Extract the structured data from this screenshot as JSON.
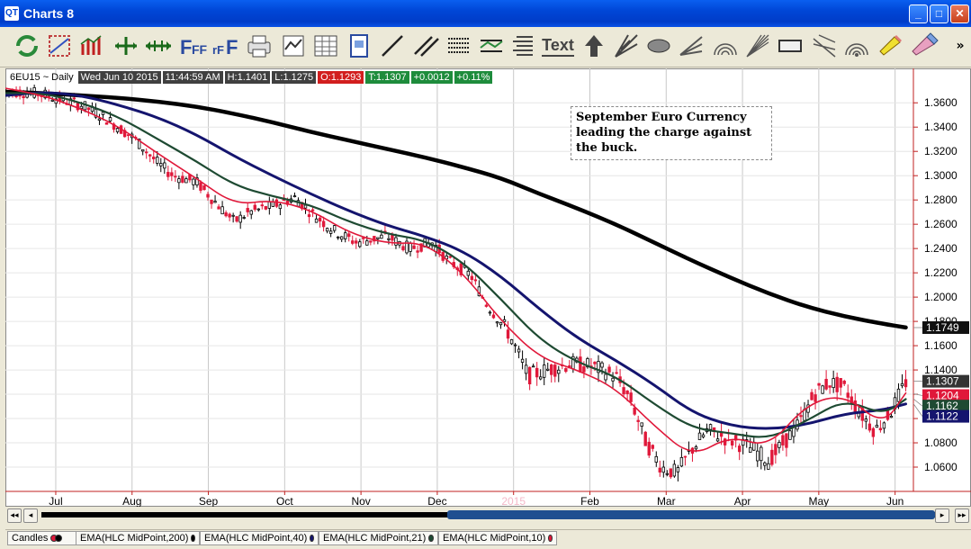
{
  "window": {
    "title": "Charts 8",
    "app_icon": "QT"
  },
  "toolbar": {
    "icons": [
      "refresh-icon",
      "studies-icon",
      "bar-chart-icon",
      "cursor-cross-icon",
      "cursor-arrows-icon",
      "font-size-icon",
      "font-size-small-icon",
      "print-icon",
      "chart-window-icon",
      "spreadsheet-icon",
      "page-setup-icon",
      "trendline-icon",
      "parallel-lines-icon",
      "horizontal-lines-icon",
      "channel-icon",
      "fibonacci-icon",
      "text-icon",
      "arrow-up-icon",
      "gann-fan-icon",
      "ellipse-icon",
      "speed-lines-icon",
      "fib-arcs-icon",
      "gann-lines-icon",
      "rectangle-icon",
      "andrews-fork-icon",
      "fib-circles-icon",
      "highlighter-icon",
      "eraser-icon"
    ],
    "text_tool_label": "Text",
    "overflow": "»"
  },
  "infobar": {
    "symbol": "6EU15 ~ Daily",
    "datetime": "Wed Jun 10 2015",
    "time": "11:44:59 AM",
    "high": "H:1.1401",
    "low": "L:1.1275",
    "open": "O:1.1293",
    "trade": "T:1.1307",
    "change": "+0.0012",
    "change_pct": "+0.11%"
  },
  "annotation": {
    "lines": [
      "September Euro Currency",
      "leading the charge against",
      "the buck."
    ]
  },
  "legend": {
    "items": [
      {
        "label": "Candles",
        "colors": [
          "#e0183a",
          "#000000"
        ]
      },
      {
        "label": "EMA(HLC MidPoint,200)",
        "color": "#000000"
      },
      {
        "label": "EMA(HLC MidPoint,40)",
        "color": "#14146e"
      },
      {
        "label": "EMA(HLC MidPoint,21)",
        "color": "#1e4a32"
      },
      {
        "label": "EMA(HLC MidPoint,10)",
        "color": "#e0183a"
      }
    ]
  },
  "chart_data": {
    "type": "line",
    "ylim": [
      1.04,
      1.375
    ],
    "y_ticks": [
      "1.3600",
      "1.3400",
      "1.3200",
      "1.3000",
      "1.2800",
      "1.2600",
      "1.2400",
      "1.2200",
      "1.2000",
      "1.1800",
      "1.1600",
      "1.1400",
      "1.1200",
      "1.1000",
      "1.0800",
      "1.0600"
    ],
    "x_ticks": [
      "Jul",
      "Aug",
      "Sep",
      "Oct",
      "Nov",
      "Dec",
      "2015",
      "Feb",
      "Mar",
      "Apr",
      "May",
      "Jun"
    ],
    "x_tick_pos": [
      0.66,
      1.66,
      2.66,
      3.66,
      4.66,
      5.66,
      6.66,
      7.66,
      8.66,
      9.66,
      10.66,
      11.66
    ],
    "x_range": [
      0,
      11.9
    ],
    "highlight_tick": "2015",
    "colors": {
      "ema200": "#000000",
      "ema40": "#14146e",
      "ema21": "#1e4a32",
      "ema10": "#e0183a",
      "candle_down": "#e0183a",
      "candle_up": "#000000"
    },
    "series": [
      {
        "name": "EMA(HLC MidPoint,200)",
        "points": [
          [
            0,
            1.369
          ],
          [
            0.5,
            1.368
          ],
          [
            1,
            1.366
          ],
          [
            1.5,
            1.364
          ],
          [
            2,
            1.361
          ],
          [
            2.5,
            1.357
          ],
          [
            3,
            1.351
          ],
          [
            3.5,
            1.344
          ],
          [
            4,
            1.336
          ],
          [
            4.5,
            1.329
          ],
          [
            5,
            1.322
          ],
          [
            5.5,
            1.315
          ],
          [
            6,
            1.307
          ],
          [
            6.5,
            1.298
          ],
          [
            7,
            1.285
          ],
          [
            7.5,
            1.273
          ],
          [
            8,
            1.26
          ],
          [
            8.5,
            1.245
          ],
          [
            9,
            1.23
          ],
          [
            9.5,
            1.216
          ],
          [
            10,
            1.203
          ],
          [
            10.5,
            1.192
          ],
          [
            11,
            1.184
          ],
          [
            11.5,
            1.178
          ],
          [
            11.8,
            1.175
          ]
        ]
      },
      {
        "name": "EMA(HLC MidPoint,40)",
        "points": [
          [
            0,
            1.366
          ],
          [
            0.5,
            1.369
          ],
          [
            1,
            1.366
          ],
          [
            1.5,
            1.358
          ],
          [
            2,
            1.348
          ],
          [
            2.5,
            1.334
          ],
          [
            3,
            1.316
          ],
          [
            3.5,
            1.3
          ],
          [
            4,
            1.285
          ],
          [
            4.5,
            1.271
          ],
          [
            5,
            1.259
          ],
          [
            5.5,
            1.25
          ],
          [
            6,
            1.238
          ],
          [
            6.5,
            1.217
          ],
          [
            7,
            1.19
          ],
          [
            7.5,
            1.166
          ],
          [
            8,
            1.148
          ],
          [
            8.5,
            1.128
          ],
          [
            9,
            1.105
          ],
          [
            9.5,
            1.094
          ],
          [
            10,
            1.091
          ],
          [
            10.5,
            1.095
          ],
          [
            11,
            1.104
          ],
          [
            11.5,
            1.107
          ],
          [
            11.8,
            1.112
          ]
        ]
      },
      {
        "name": "EMA(HLC MidPoint,21)",
        "points": [
          [
            0,
            1.368
          ],
          [
            0.5,
            1.368
          ],
          [
            1,
            1.36
          ],
          [
            1.5,
            1.348
          ],
          [
            2,
            1.33
          ],
          [
            2.5,
            1.312
          ],
          [
            3,
            1.292
          ],
          [
            3.5,
            1.283
          ],
          [
            4,
            1.276
          ],
          [
            4.5,
            1.262
          ],
          [
            5,
            1.252
          ],
          [
            5.5,
            1.247
          ],
          [
            6,
            1.229
          ],
          [
            6.5,
            1.198
          ],
          [
            7,
            1.165
          ],
          [
            7.5,
            1.146
          ],
          [
            8,
            1.135
          ],
          [
            8.5,
            1.112
          ],
          [
            9,
            1.092
          ],
          [
            9.5,
            1.088
          ],
          [
            10,
            1.083
          ],
          [
            10.5,
            1.098
          ],
          [
            11,
            1.116
          ],
          [
            11.5,
            1.103
          ],
          [
            11.8,
            1.116
          ]
        ]
      },
      {
        "name": "EMA(HLC MidPoint,10)",
        "points": [
          [
            0,
            1.372
          ],
          [
            0.5,
            1.366
          ],
          [
            1,
            1.355
          ],
          [
            1.5,
            1.34
          ],
          [
            2,
            1.318
          ],
          [
            2.5,
            1.298
          ],
          [
            3,
            1.276
          ],
          [
            3.5,
            1.28
          ],
          [
            4,
            1.272
          ],
          [
            4.5,
            1.253
          ],
          [
            5,
            1.244
          ],
          [
            5.5,
            1.245
          ],
          [
            6,
            1.22
          ],
          [
            6.5,
            1.18
          ],
          [
            7,
            1.15
          ],
          [
            7.5,
            1.14
          ],
          [
            8,
            1.125
          ],
          [
            8.5,
            1.094
          ],
          [
            9,
            1.068
          ],
          [
            9.5,
            1.086
          ],
          [
            10,
            1.076
          ],
          [
            10.5,
            1.112
          ],
          [
            11,
            1.12
          ],
          [
            11.5,
            1.094
          ],
          [
            11.8,
            1.121
          ]
        ]
      }
    ],
    "candle_path": [
      [
        0,
        1.37
      ],
      [
        0.5,
        1.367
      ],
      [
        1,
        1.358
      ],
      [
        1.3,
        1.348
      ],
      [
        1.7,
        1.33
      ],
      [
        2,
        1.31
      ],
      [
        2.2,
        1.3
      ],
      [
        2.5,
        1.295
      ],
      [
        2.8,
        1.275
      ],
      [
        3,
        1.262
      ],
      [
        3.2,
        1.27
      ],
      [
        3.5,
        1.275
      ],
      [
        3.8,
        1.282
      ],
      [
        4,
        1.27
      ],
      [
        4.3,
        1.255
      ],
      [
        4.6,
        1.245
      ],
      [
        5,
        1.25
      ],
      [
        5.3,
        1.24
      ],
      [
        5.6,
        1.245
      ],
      [
        5.8,
        1.23
      ],
      [
        6.1,
        1.218
      ],
      [
        6.3,
        1.195
      ],
      [
        6.6,
        1.17
      ],
      [
        6.85,
        1.135
      ],
      [
        7.1,
        1.14
      ],
      [
        7.4,
        1.145
      ],
      [
        7.7,
        1.143
      ],
      [
        8,
        1.135
      ],
      [
        8.2,
        1.115
      ],
      [
        8.4,
        1.08
      ],
      [
        8.6,
        1.06
      ],
      [
        8.8,
        1.055
      ],
      [
        9,
        1.075
      ],
      [
        9.2,
        1.09
      ],
      [
        9.4,
        1.085
      ],
      [
        9.6,
        1.08
      ],
      [
        9.8,
        1.075
      ],
      [
        10.0,
        1.065
      ],
      [
        10.2,
        1.08
      ],
      [
        10.4,
        1.095
      ],
      [
        10.6,
        1.12
      ],
      [
        10.8,
        1.13
      ],
      [
        11.0,
        1.125
      ],
      [
        11.2,
        1.105
      ],
      [
        11.4,
        1.09
      ],
      [
        11.6,
        1.105
      ],
      [
        11.8,
        1.13
      ]
    ],
    "price_labels": [
      {
        "text": "1.1749",
        "value": 1.1749,
        "bg": "#111111"
      },
      {
        "text": "1.1307",
        "value": 1.1307,
        "bg": "#333333"
      },
      {
        "text": "1.1204",
        "value": 1.1204,
        "bg": "#e0183a"
      },
      {
        "text": "1.1162",
        "value": 1.1162,
        "bg": "#1e4a32"
      },
      {
        "text": "1.1122",
        "value": 1.1122,
        "bg": "#14146e"
      }
    ]
  }
}
